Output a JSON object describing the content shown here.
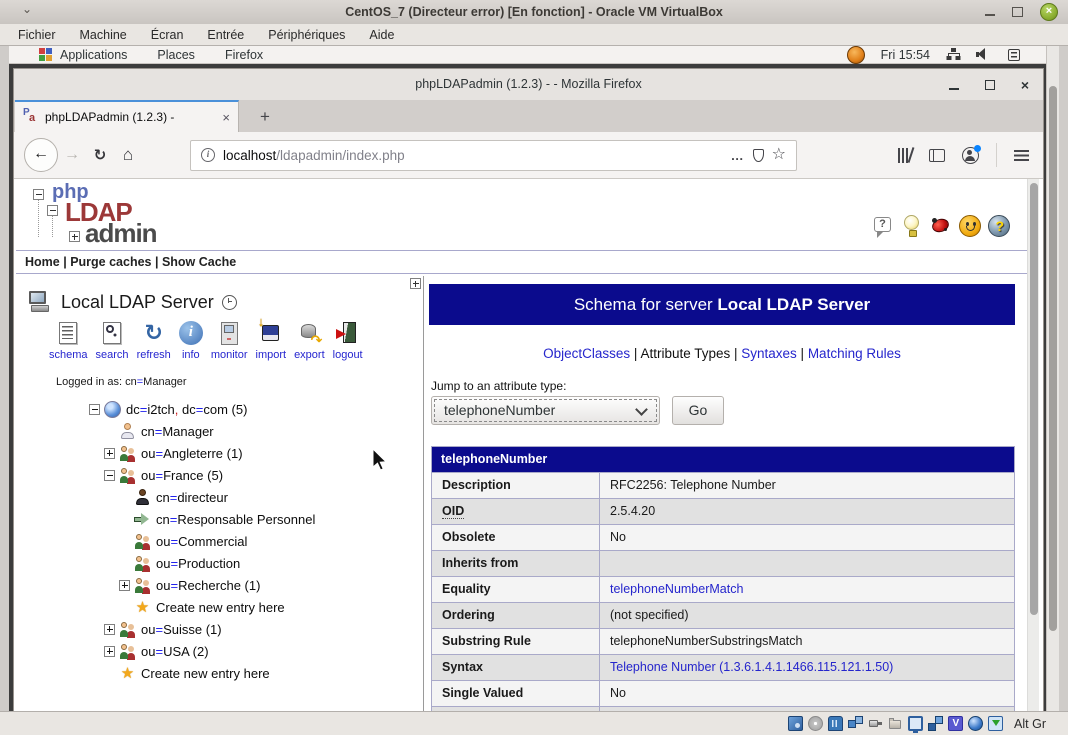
{
  "vbox_window": {
    "title": "CentOS_7 (Directeur error) [En fonction] - Oracle VM VirtualBox",
    "menu_items": [
      "Fichier",
      "Machine",
      "Écran",
      "Entrée",
      "Périphériques",
      "Aide"
    ],
    "status_bar": {
      "icons": [
        "hard-disk",
        "optical-disc",
        "audio",
        "network",
        "usb",
        "shared-folders",
        "display",
        "recording",
        "features",
        "mouse-integration",
        "keyboard"
      ],
      "keyboard_indicator": "Alt Gr"
    }
  },
  "desktop_bar": {
    "menus": [
      "Applications",
      "Places",
      "Firefox"
    ],
    "clock": "Fri 15:54",
    "tray_icons": [
      "network",
      "volume",
      "message-list"
    ]
  },
  "browser": {
    "window_title": "phpLDAPadmin (1.2.3) - - Mozilla Firefox",
    "tab": {
      "title": "phpLDAPadmin (1.2.3) -"
    },
    "urlbar": {
      "host": "localhost",
      "path": "/ldapadmin/index.php"
    }
  },
  "app": {
    "logo": {
      "php": "php",
      "ldap": "LDAP",
      "admin": "admin"
    },
    "header_links": [
      "Home",
      "Purge caches",
      "Show Cache"
    ],
    "help_icons": [
      "tooltip",
      "idea",
      "bug",
      "donate",
      "help"
    ],
    "tree_pane": {
      "server_label": "Local LDAP Server",
      "toolbar": [
        "schema",
        "search",
        "refresh",
        "info",
        "monitor",
        "import",
        "export",
        "logout"
      ],
      "logged_in": "Logged in as: cn=Manager",
      "items": [
        {
          "indent": 0,
          "expander": "minus",
          "icon": "globe",
          "text": "dc=i2tch, dc=com (5)"
        },
        {
          "indent": 1,
          "expander": "",
          "icon": "person",
          "text": "cn=Manager"
        },
        {
          "indent": 1,
          "expander": "plus",
          "icon": "group",
          "text": "ou=Angleterre (1)"
        },
        {
          "indent": 1,
          "expander": "minus",
          "icon": "group",
          "text": "ou=France (5)"
        },
        {
          "indent": 2,
          "expander": "",
          "icon": "person-dark",
          "text": "cn=directeur"
        },
        {
          "indent": 2,
          "expander": "",
          "icon": "green-arrow",
          "text": "cn=Responsable Personnel"
        },
        {
          "indent": 2,
          "expander": "",
          "icon": "group",
          "text": "ou=Commercial"
        },
        {
          "indent": 2,
          "expander": "",
          "icon": "group",
          "text": "ou=Production"
        },
        {
          "indent": 2,
          "expander": "plus",
          "icon": "group",
          "text": "ou=Recherche (1)"
        },
        {
          "indent": 2,
          "expander": "",
          "icon": "star",
          "text": "Create new entry here"
        },
        {
          "indent": 1,
          "expander": "plus",
          "icon": "group",
          "text": "ou=Suisse (1)"
        },
        {
          "indent": 1,
          "expander": "plus",
          "icon": "group",
          "text": "ou=USA (2)"
        },
        {
          "indent": 1,
          "expander": "",
          "icon": "star",
          "text": "Create new entry here"
        }
      ]
    },
    "main_pane": {
      "banner": {
        "prefix": "Schema for server ",
        "server": "Local LDAP Server"
      },
      "schema_nav": [
        {
          "label": "ObjectClasses",
          "link": true
        },
        {
          "label": "Attribute Types",
          "link": false
        },
        {
          "label": "Syntaxes",
          "link": true
        },
        {
          "label": "Matching Rules",
          "link": true
        }
      ],
      "jump_label": "Jump to an attribute type:",
      "attribute_select_value": "telephoneNumber",
      "go_button": "Go",
      "attribute_table": {
        "header": "telephoneNumber",
        "rows": [
          {
            "label": "Description",
            "value": "RFC2256: Telephone Number"
          },
          {
            "label": "OID",
            "value": "2.5.4.20",
            "label_dotted": true
          },
          {
            "label": "Obsolete",
            "value": "No"
          },
          {
            "label": "Inherits from",
            "value": ""
          },
          {
            "label": "Equality",
            "value": "telephoneNumberMatch",
            "link": true
          },
          {
            "label": "Ordering",
            "value": "(not specified)"
          },
          {
            "label": "Substring Rule",
            "value": "telephoneNumberSubstringsMatch"
          },
          {
            "label": "Syntax",
            "value": "Telephone Number (1.3.6.1.4.1.1466.115.121.1.50)",
            "link": true
          },
          {
            "label": "Single Valued",
            "value": "No"
          }
        ]
      }
    }
  },
  "colors": {
    "banner_bg": "#0b0b8d",
    "link_blue": "#2525cc",
    "tab_accent": "#4a90d9",
    "close_button_green": "#8db032",
    "equals_blue": "#2222ee",
    "comma_red": "#cc2222"
  }
}
